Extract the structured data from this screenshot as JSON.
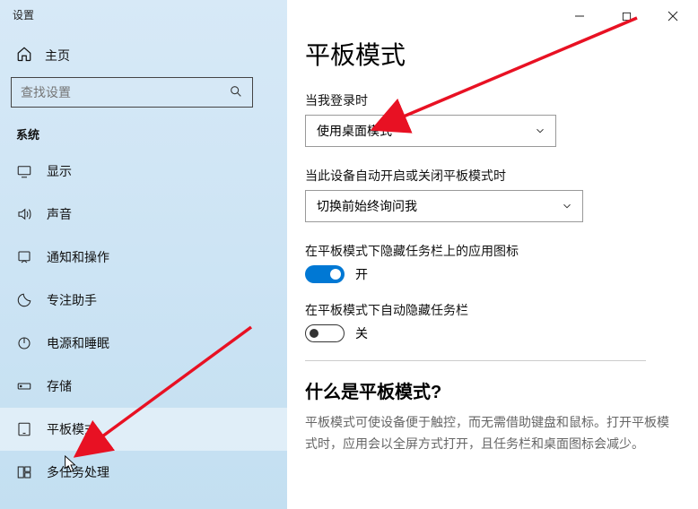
{
  "window": {
    "title": "设置"
  },
  "titlebar": {
    "minimize": "—",
    "maximize": "□",
    "close": "×"
  },
  "sidebar": {
    "home_label": "主页",
    "search_placeholder": "查找设置",
    "section_label": "系统",
    "items": [
      {
        "label": "显示"
      },
      {
        "label": "声音"
      },
      {
        "label": "通知和操作"
      },
      {
        "label": "专注助手"
      },
      {
        "label": "电源和睡眠"
      },
      {
        "label": "存储"
      },
      {
        "label": "平板模式"
      },
      {
        "label": "多任务处理"
      }
    ]
  },
  "main": {
    "title": "平板模式",
    "field1_label": "当我登录时",
    "field1_value": "使用桌面模式",
    "field2_label": "当此设备自动开启或关闭平板模式时",
    "field2_value": "切换前始终询问我",
    "toggle1_label": "在平板模式下隐藏任务栏上的应用图标",
    "toggle1_state": "开",
    "toggle2_label": "在平板模式下自动隐藏任务栏",
    "toggle2_state": "关",
    "subheading": "什么是平板模式?",
    "description": "平板模式可使设备便于触控，而无需借助键盘和鼠标。打开平板模式时，应用会以全屏方式打开，且任务栏和桌面图标会减少。"
  }
}
